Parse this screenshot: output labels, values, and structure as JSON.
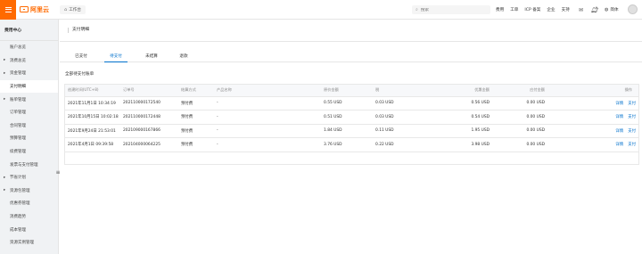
{
  "header": {
    "logo_text": "阿里云",
    "workbench_label": "工作台",
    "search_placeholder": "搜索",
    "links": [
      "费用",
      "工单",
      "ICP 备案",
      "企业",
      "支持"
    ],
    "notification_count": "6",
    "user_label": "简体"
  },
  "sidebar": {
    "title": "费用中心",
    "items": [
      {
        "label": "账户总览",
        "caret": false
      },
      {
        "label": "消费总览",
        "caret": true
      },
      {
        "label": "资金管理",
        "caret": true
      },
      {
        "label": "支付明细",
        "caret": false,
        "active": true
      },
      {
        "label": "账单管理",
        "caret": true
      },
      {
        "label": "订单管理",
        "caret": false
      },
      {
        "label": "合同管理",
        "caret": false
      },
      {
        "label": "预算管理",
        "caret": false
      },
      {
        "label": "续费管理",
        "caret": false
      },
      {
        "label": "发票与支付管理",
        "caret": false
      },
      {
        "label": "节省计划",
        "caret": true
      },
      {
        "label": "资源包管理",
        "caret": true
      },
      {
        "label": "优惠券管理",
        "caret": false
      },
      {
        "label": "消费趋势",
        "caret": false
      },
      {
        "label": "成本管理",
        "caret": false
      },
      {
        "label": "资源实例管理",
        "caret": false
      }
    ]
  },
  "main": {
    "page_title": "支付明细",
    "tabs": [
      {
        "label": "已支付",
        "active": false
      },
      {
        "label": "待支付",
        "active": true
      },
      {
        "label": "未结算",
        "active": false
      },
      {
        "label": "退款",
        "active": false
      }
    ],
    "section_label": "全部待支付账单",
    "table": {
      "columns": [
        "创建时间(UTC+8)",
        "订单号",
        "结算方式",
        "产品名称",
        "原价金额",
        "税",
        "优惠金额",
        "应付金额",
        "操作"
      ],
      "rows": [
        {
          "created": "2021年11月1日 10:34:19",
          "order": "202110000172540",
          "method": "预付费",
          "product": "-",
          "original": "0.55 USD",
          "tax": "0.03 USD",
          "discount": "0.56 USD",
          "payable": "0.00 USD",
          "ops": [
            "详情",
            "支付"
          ]
        },
        {
          "created": "2021年10月15日 10:02:18",
          "order": "202110000172448",
          "method": "预付费",
          "product": "-",
          "original": "0.51 USD",
          "tax": "0.03 USD",
          "discount": "0.54 USD",
          "payable": "0.00 USD",
          "ops": [
            "详情",
            "支付"
          ]
        },
        {
          "created": "2021年9月24日 21:53:01",
          "order": "202109000167866",
          "method": "预付费",
          "product": "-",
          "original": "1.84 USD",
          "tax": "0.11 USD",
          "discount": "1.95 USD",
          "payable": "0.00 USD",
          "ops": [
            "详情",
            "支付"
          ]
        },
        {
          "created": "2021年4月1日 09:39:58",
          "order": "202104000064225",
          "method": "预付费",
          "product": "-",
          "original": "3.76 USD",
          "tax": "0.22 USD",
          "discount": "3.98 USD",
          "payable": "0.00 USD",
          "ops": [
            "详情",
            "支付"
          ]
        }
      ]
    }
  },
  "colors": {
    "accent": "#ff6a00",
    "link": "#0070cc",
    "sidebar_bg": "#f0f2f4"
  }
}
